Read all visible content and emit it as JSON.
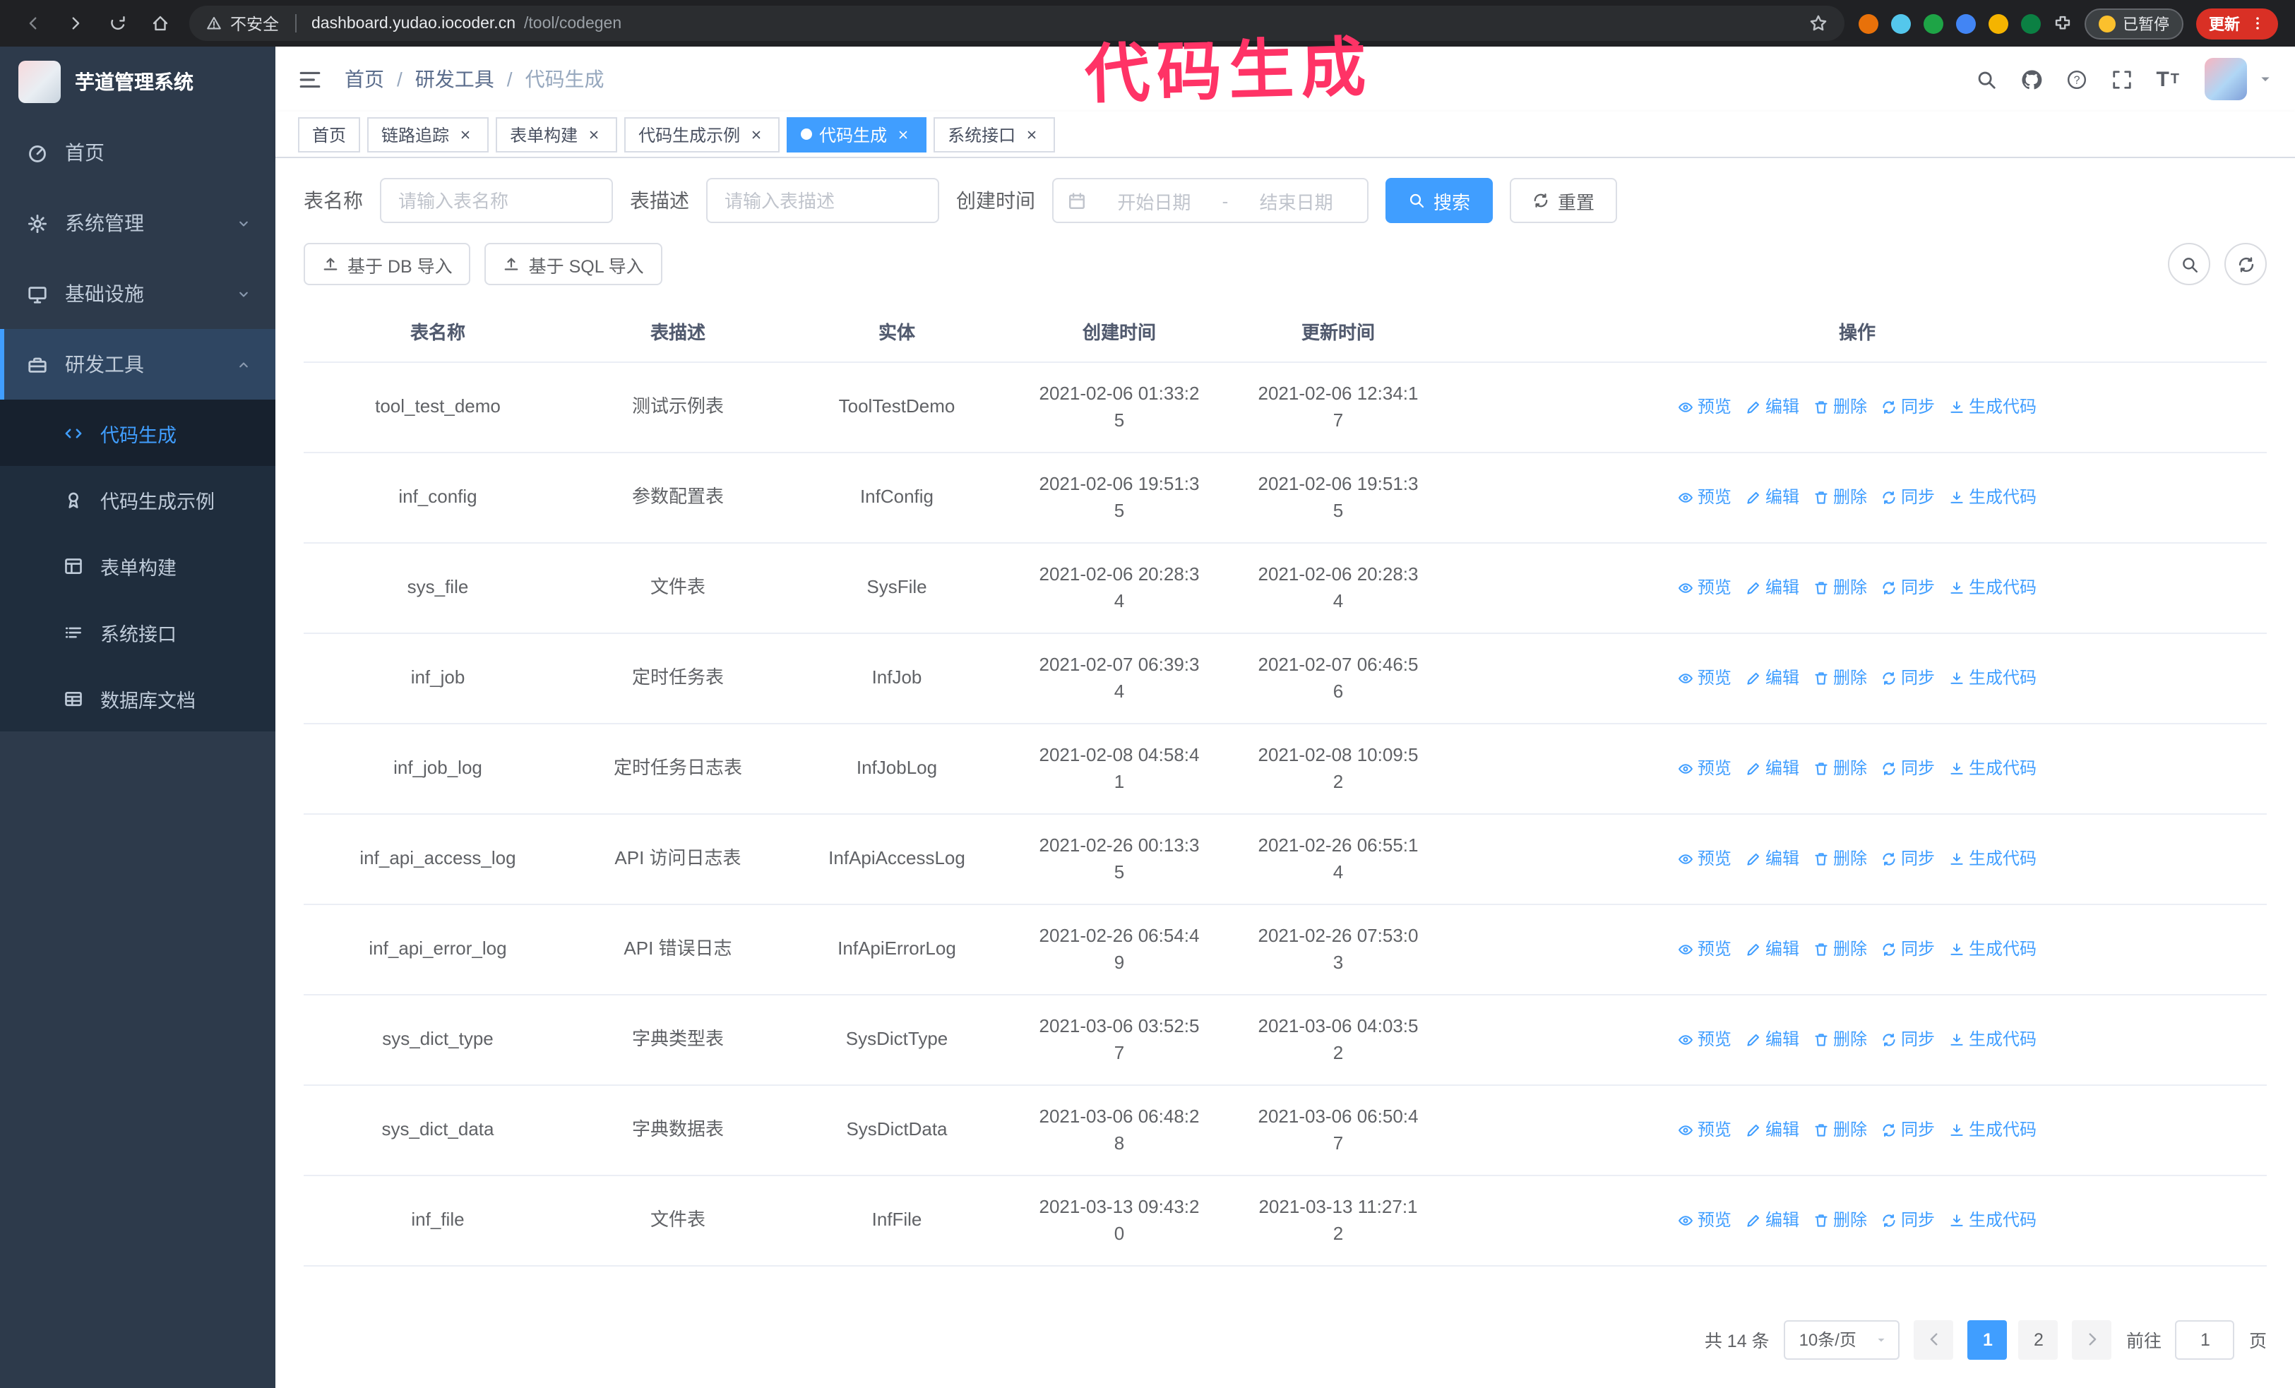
{
  "annotation": {
    "text": "代码生成"
  },
  "colors": {
    "accent": "#409eff",
    "sidebar-bg": "#2d3a4b",
    "submenu-bg": "#1f2d3d",
    "annotation": "#ff3366",
    "update-badge": "#d93025",
    "chrome-bg": "#202124"
  },
  "browser": {
    "security_label": "不安全",
    "url_host": "dashboard.yudao.iocoder.cn",
    "url_path": "/tool/codegen",
    "paused_badge": "已暂停",
    "update_button": "更新",
    "extension_dot_colors": [
      "#e8710a",
      "#54c7ec",
      "#1ea446",
      "#4285f4",
      "#f5b400",
      "#0b8043"
    ]
  },
  "sidebar": {
    "logo_title": "芋道管理系统",
    "menu": [
      {
        "label": "首页",
        "icon": "dashboard-icon"
      },
      {
        "label": "系统管理",
        "icon": "gear-icon",
        "chevron": "down"
      },
      {
        "label": "基础设施",
        "icon": "monitor-icon",
        "chevron": "down"
      },
      {
        "label": "研发工具",
        "icon": "tools-icon",
        "chevron": "up",
        "active_parent": true,
        "children": [
          {
            "label": "代码生成",
            "icon": "code-icon",
            "active": true
          },
          {
            "label": "代码生成示例",
            "icon": "medal-icon"
          },
          {
            "label": "表单构建",
            "icon": "form-icon"
          },
          {
            "label": "系统接口",
            "icon": "api-icon"
          },
          {
            "label": "数据库文档",
            "icon": "database-icon"
          }
        ]
      }
    ]
  },
  "header": {
    "breadcrumb": [
      "首页",
      "研发工具",
      "代码生成"
    ],
    "breadcrumb_separator": "/"
  },
  "tabs": [
    {
      "label": "首页",
      "closable": false,
      "active": false
    },
    {
      "label": "链路追踪",
      "closable": true,
      "active": false
    },
    {
      "label": "表单构建",
      "closable": true,
      "active": false
    },
    {
      "label": "代码生成示例",
      "closable": true,
      "active": false
    },
    {
      "label": "代码生成",
      "closable": true,
      "active": true
    },
    {
      "label": "系统接口",
      "closable": true,
      "active": false
    }
  ],
  "filters": {
    "table_name_label": "表名称",
    "table_name_placeholder": "请输入表名称",
    "table_desc_label": "表描述",
    "table_desc_placeholder": "请输入表描述",
    "create_time_label": "创建时间",
    "date_start_placeholder": "开始日期",
    "date_separator": "-",
    "date_end_placeholder": "结束日期",
    "search_button": "搜索",
    "reset_button": "重置"
  },
  "toolbar": {
    "import_db_button": "基于 DB 导入",
    "import_sql_button": "基于 SQL 导入"
  },
  "table": {
    "columns": [
      "表名称",
      "表描述",
      "实体",
      "创建时间",
      "更新时间",
      "操作"
    ],
    "row_actions": [
      {
        "label": "预览",
        "icon": "eye-icon",
        "key": "preview"
      },
      {
        "label": "编辑",
        "icon": "edit-icon",
        "key": "edit"
      },
      {
        "label": "删除",
        "icon": "delete-icon",
        "key": "delete"
      },
      {
        "label": "同步",
        "icon": "sync-icon",
        "key": "sync"
      },
      {
        "label": "生成代码",
        "icon": "download-icon",
        "key": "generate"
      }
    ],
    "rows": [
      {
        "name": "tool_test_demo",
        "desc": "测试示例表",
        "entity": "ToolTestDemo",
        "created": "2021-02-06 01:33:25",
        "updated": "2021-02-06 12:34:17"
      },
      {
        "name": "inf_config",
        "desc": "参数配置表",
        "entity": "InfConfig",
        "created": "2021-02-06 19:51:35",
        "updated": "2021-02-06 19:51:35"
      },
      {
        "name": "sys_file",
        "desc": "文件表",
        "entity": "SysFile",
        "created": "2021-02-06 20:28:34",
        "updated": "2021-02-06 20:28:34"
      },
      {
        "name": "inf_job",
        "desc": "定时任务表",
        "entity": "InfJob",
        "created": "2021-02-07 06:39:34",
        "updated": "2021-02-07 06:46:56"
      },
      {
        "name": "inf_job_log",
        "desc": "定时任务日志表",
        "entity": "InfJobLog",
        "created": "2021-02-08 04:58:41",
        "updated": "2021-02-08 10:09:52"
      },
      {
        "name": "inf_api_access_log",
        "desc": "API 访问日志表",
        "entity": "InfApiAccessLog",
        "created": "2021-02-26 00:13:35",
        "updated": "2021-02-26 06:55:14"
      },
      {
        "name": "inf_api_error_log",
        "desc": "API 错误日志",
        "entity": "InfApiErrorLog",
        "created": "2021-02-26 06:54:49",
        "updated": "2021-02-26 07:53:03"
      },
      {
        "name": "sys_dict_type",
        "desc": "字典类型表",
        "entity": "SysDictType",
        "created": "2021-03-06 03:52:57",
        "updated": "2021-03-06 04:03:52"
      },
      {
        "name": "sys_dict_data",
        "desc": "字典数据表",
        "entity": "SysDictData",
        "created": "2021-03-06 06:48:28",
        "updated": "2021-03-06 06:50:47"
      },
      {
        "name": "inf_file",
        "desc": "文件表",
        "entity": "InfFile",
        "created": "2021-03-13 09:43:20",
        "updated": "2021-03-13 11:27:12"
      }
    ]
  },
  "pagination": {
    "total": "共 14 条",
    "page_size": "10条/页",
    "pages": [
      "1",
      "2"
    ],
    "active_page": "1",
    "goto_label": "前往",
    "goto_value": "1",
    "goto_suffix": "页"
  }
}
